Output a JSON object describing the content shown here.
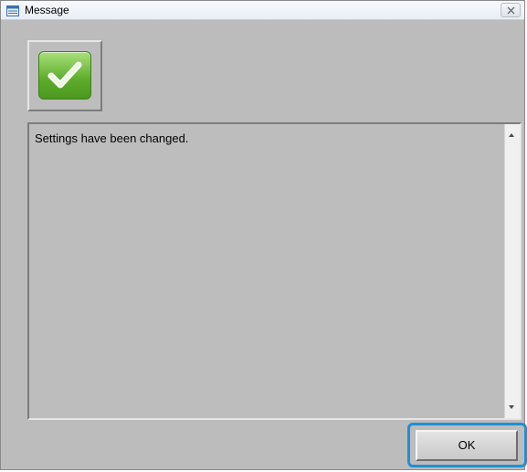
{
  "window": {
    "title": "Message",
    "app_icon": "application-window-icon",
    "close_icon": "close-x-icon"
  },
  "status": {
    "icon": "checkmark-success-icon",
    "color": "#5dab2a"
  },
  "message": {
    "text": "Settings have been changed."
  },
  "buttons": {
    "ok_label": "OK"
  },
  "colors": {
    "dialog_background": "#bcbcbc",
    "focus_highlight": "#1f8fd4"
  }
}
